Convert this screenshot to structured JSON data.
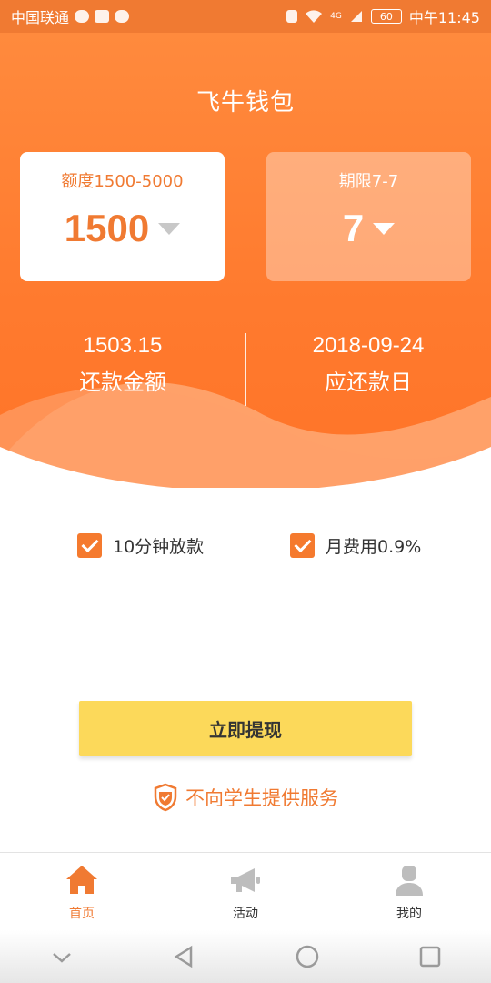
{
  "status_bar": {
    "carrier": "中国联通",
    "network": "4G",
    "battery": "60",
    "time": "中午11:45"
  },
  "app": {
    "title": "飞牛钱包",
    "brand_color": "#f07a32"
  },
  "loan": {
    "amount": {
      "label": "额度1500-5000",
      "value": "1500"
    },
    "term": {
      "label": "期限7-7",
      "value": "7"
    }
  },
  "summary": {
    "repay_amount": {
      "value": "1503.15",
      "label": "还款金额"
    },
    "due_date": {
      "value": "2018-09-24",
      "label": "应还款日"
    }
  },
  "options": [
    {
      "label": "10分钟放款",
      "checked": true
    },
    {
      "label": "月费用0.9%",
      "checked": true
    }
  ],
  "action": {
    "withdraw_label": "立即提现"
  },
  "notice": {
    "text": "不向学生提供服务"
  },
  "tabbar": {
    "items": [
      {
        "label": "首页",
        "icon": "home-icon",
        "active": true
      },
      {
        "label": "活动",
        "icon": "megaphone-icon",
        "active": false
      },
      {
        "label": "我的",
        "icon": "person-icon",
        "active": false
      }
    ]
  }
}
